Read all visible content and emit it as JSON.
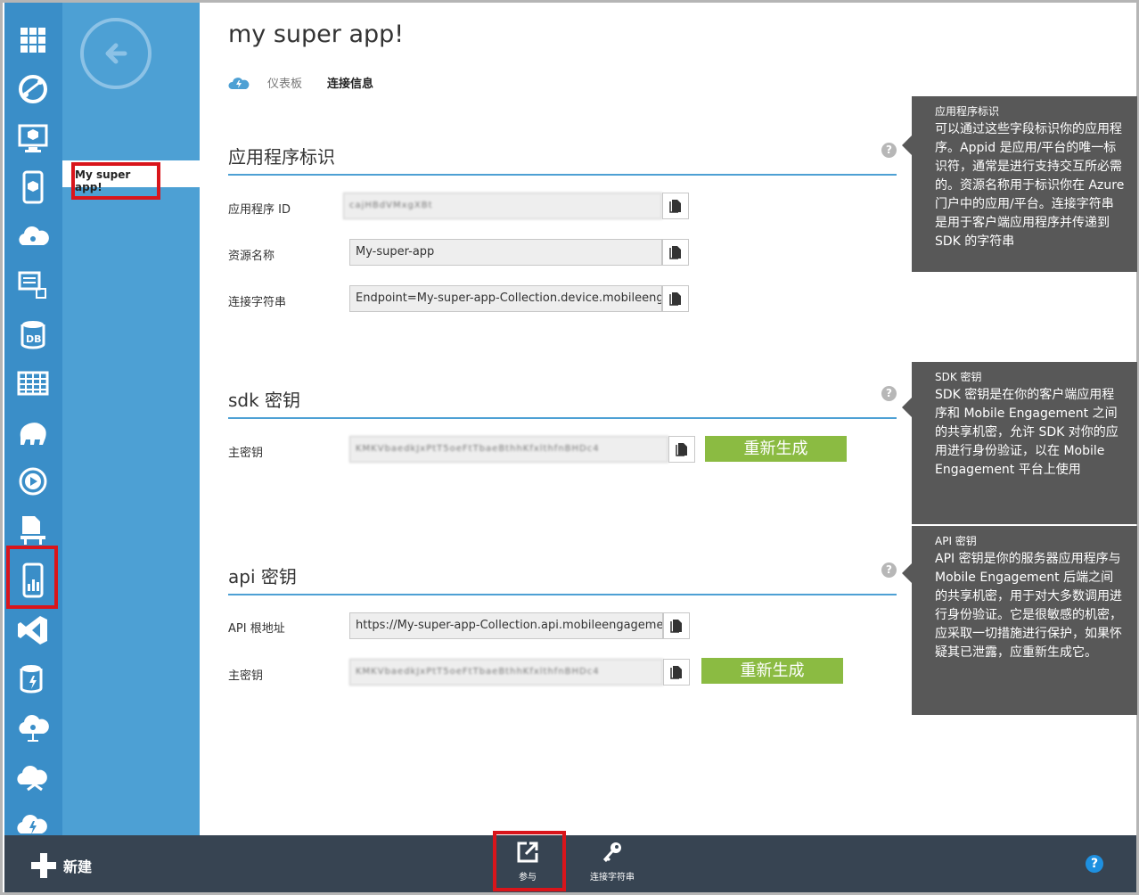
{
  "app": {
    "title": "my super app!"
  },
  "nav": {
    "item_label": "My super app!"
  },
  "tabs": [
    {
      "label": "仪表板"
    },
    {
      "label": "连接信息"
    }
  ],
  "sections": {
    "app_id": {
      "title": "应用程序标识",
      "fields": [
        {
          "label": "应用程序 ID",
          "value": "cajHBdVMxgXBt"
        },
        {
          "label": "资源名称",
          "value": "My-super-app"
        },
        {
          "label": "连接字符串",
          "value": "Endpoint=My-super-app-Collection.device.mobileeng"
        }
      ]
    },
    "sdk": {
      "title": "sdk 密钥",
      "key_label": "主密钥",
      "key_value": "KMKVbaedkJxPtT5oeFtTbaeBthhKfxlthfnBHDc4",
      "regen": "重新生成"
    },
    "api": {
      "title": "api 密钥",
      "url_label": "API 根地址",
      "url_value": "https://My-super-app-Collection.api.mobileengageme",
      "key_label": "主密钥",
      "key_value": "KMKVbaedkJxPtT5oeFtTbaeBthhKfxlthfnBHDc4",
      "regen": "重新生成"
    }
  },
  "tips": {
    "app_id": {
      "title": "应用程序标识",
      "body": "可以通过这些字段标识你的应用程序。Appid 是应用/平台的唯一标识符，通常是进行支持交互所必需的。资源名称用于标识你在 Azure 门户中的应用/平台。连接字符串是用于客户端应用程序并传递到 SDK 的字符串"
    },
    "sdk": {
      "title": "SDK 密钥",
      "body": "SDK 密钥是在你的客户端应用程序和 Mobile Engagement 之间的共享机密，允许 SDK 对你的应用进行身份验证，以在 Mobile Engagement 平台上使用"
    },
    "api": {
      "title": "API 密钥",
      "body": "API 密钥是你的服务器应用程序与 Mobile Engagement 后端之间的共享机密，用于对大多数调用进行身份验证。它是很敏感的机密，应采取一切措施进行保护，如果怀疑其已泄露，应重新生成它。"
    }
  },
  "help_mark": "?",
  "bottom": {
    "new_label": "新建",
    "engage_label": "参与",
    "conn_label": "连接字符串",
    "help": "?"
  },
  "colors": {
    "rail": "#3a8ec8",
    "nav": "#4da0d4",
    "accent_green": "#8bbb42",
    "bottom_bar": "#374452",
    "highlight_red": "#d9151b",
    "tip_bg": "#585858"
  }
}
